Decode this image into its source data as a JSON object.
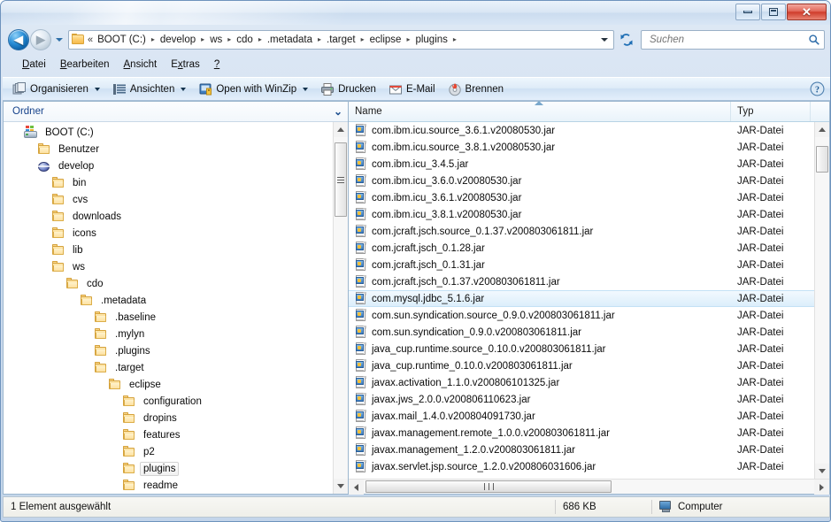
{
  "window": {
    "minimize_title": "Minimieren",
    "maximize_title": "Maximieren",
    "close_title": "Schließen"
  },
  "nav": {
    "back_glyph": "◀",
    "forward_glyph": "▶",
    "recent_pages_label": "Zuletzt besuchte Seiten",
    "crumb_lead": "«",
    "separator": "▸",
    "breadcrumbs": [
      {
        "label": "BOOT (C:)"
      },
      {
        "label": "develop"
      },
      {
        "label": "ws"
      },
      {
        "label": "cdo"
      },
      {
        "label": ".metadata"
      },
      {
        "label": ".target"
      },
      {
        "label": "eclipse"
      },
      {
        "label": "plugins"
      }
    ],
    "refresh_label": "Aktualisieren"
  },
  "search": {
    "value": "",
    "placeholder": "Suchen",
    "icon": "search-icon"
  },
  "menu": {
    "items": [
      {
        "pre": "",
        "accel": "D",
        "post": "atei"
      },
      {
        "pre": "",
        "accel": "B",
        "post": "earbeiten"
      },
      {
        "pre": "",
        "accel": "A",
        "post": "nsicht"
      },
      {
        "pre": "E",
        "accel": "x",
        "post": "tras"
      },
      {
        "pre": "",
        "accel": "?",
        "post": ""
      }
    ]
  },
  "toolbar": {
    "buttons": [
      {
        "label": "Organisieren",
        "icon": "organize-icon",
        "caret": true
      },
      {
        "label": "Ansichten",
        "icon": "views-icon",
        "caret": true
      },
      {
        "label": "Open with WinZip",
        "icon": "winzip-icon",
        "caret": true
      },
      {
        "label": "Drucken",
        "icon": "printer-icon",
        "caret": false
      },
      {
        "label": "E-Mail",
        "icon": "mail-icon",
        "caret": false
      },
      {
        "label": "Brennen",
        "icon": "burn-icon",
        "caret": false
      }
    ],
    "help_label": "Hilfe",
    "help_icon": "help-icon"
  },
  "tree": {
    "header": "Ordner",
    "header_icon": "chevron-down-icon",
    "items": [
      {
        "label": "BOOT (C:)",
        "indent": 0,
        "icon": "drive-icon",
        "selected": false
      },
      {
        "label": "Benutzer",
        "indent": 1,
        "icon": "folder-icon",
        "selected": false
      },
      {
        "label": "develop",
        "indent": 1,
        "icon": "globe-icon",
        "selected": false
      },
      {
        "label": "bin",
        "indent": 2,
        "icon": "folder-icon",
        "selected": false
      },
      {
        "label": "cvs",
        "indent": 2,
        "icon": "folder-icon",
        "selected": false
      },
      {
        "label": "downloads",
        "indent": 2,
        "icon": "folder-icon",
        "selected": false
      },
      {
        "label": "icons",
        "indent": 2,
        "icon": "folder-icon",
        "selected": false
      },
      {
        "label": "lib",
        "indent": 2,
        "icon": "folder-icon",
        "selected": false
      },
      {
        "label": "ws",
        "indent": 2,
        "icon": "folder-icon",
        "selected": false
      },
      {
        "label": "cdo",
        "indent": 3,
        "icon": "folder-icon",
        "selected": false
      },
      {
        "label": ".metadata",
        "indent": 4,
        "icon": "folder-icon",
        "selected": false
      },
      {
        "label": ".baseline",
        "indent": 5,
        "icon": "folder-icon",
        "selected": false
      },
      {
        "label": ".mylyn",
        "indent": 5,
        "icon": "folder-icon",
        "selected": false
      },
      {
        "label": ".plugins",
        "indent": 5,
        "icon": "folder-icon",
        "selected": false
      },
      {
        "label": ".target",
        "indent": 5,
        "icon": "folder-icon",
        "selected": false
      },
      {
        "label": "eclipse",
        "indent": 6,
        "icon": "folder-icon",
        "selected": false
      },
      {
        "label": "configuration",
        "indent": 7,
        "icon": "folder-icon",
        "selected": false
      },
      {
        "label": "dropins",
        "indent": 7,
        "icon": "folder-icon",
        "selected": false
      },
      {
        "label": "features",
        "indent": 7,
        "icon": "folder-icon",
        "selected": false
      },
      {
        "label": "p2",
        "indent": 7,
        "icon": "folder-icon",
        "selected": false
      },
      {
        "label": "plugins",
        "indent": 7,
        "icon": "folder-icon",
        "selected": true
      },
      {
        "label": "readme",
        "indent": 7,
        "icon": "folder-icon",
        "selected": false
      }
    ]
  },
  "filelist": {
    "columns": [
      {
        "key": "name",
        "label": "Name",
        "sorted": "asc"
      },
      {
        "key": "typ",
        "label": "Typ",
        "sorted": ""
      }
    ],
    "rows": [
      {
        "name": "com.ibm.icu.source_3.6.1.v20080530.jar",
        "typ": "JAR-Datei",
        "icon": "jar-file-icon",
        "selected": false
      },
      {
        "name": "com.ibm.icu.source_3.8.1.v20080530.jar",
        "typ": "JAR-Datei",
        "icon": "jar-file-icon",
        "selected": false
      },
      {
        "name": "com.ibm.icu_3.4.5.jar",
        "typ": "JAR-Datei",
        "icon": "jar-file-icon",
        "selected": false
      },
      {
        "name": "com.ibm.icu_3.6.0.v20080530.jar",
        "typ": "JAR-Datei",
        "icon": "jar-file-icon",
        "selected": false
      },
      {
        "name": "com.ibm.icu_3.6.1.v20080530.jar",
        "typ": "JAR-Datei",
        "icon": "jar-file-icon",
        "selected": false
      },
      {
        "name": "com.ibm.icu_3.8.1.v20080530.jar",
        "typ": "JAR-Datei",
        "icon": "jar-file-icon",
        "selected": false
      },
      {
        "name": "com.jcraft.jsch.source_0.1.37.v200803061811.jar",
        "typ": "JAR-Datei",
        "icon": "jar-file-icon",
        "selected": false
      },
      {
        "name": "com.jcraft.jsch_0.1.28.jar",
        "typ": "JAR-Datei",
        "icon": "jar-file-icon",
        "selected": false
      },
      {
        "name": "com.jcraft.jsch_0.1.31.jar",
        "typ": "JAR-Datei",
        "icon": "jar-file-icon",
        "selected": false
      },
      {
        "name": "com.jcraft.jsch_0.1.37.v200803061811.jar",
        "typ": "JAR-Datei",
        "icon": "jar-file-icon",
        "selected": false
      },
      {
        "name": "com.mysql.jdbc_5.1.6.jar",
        "typ": "JAR-Datei",
        "icon": "jar-file-icon",
        "selected": true
      },
      {
        "name": "com.sun.syndication.source_0.9.0.v200803061811.jar",
        "typ": "JAR-Datei",
        "icon": "jar-file-icon",
        "selected": false
      },
      {
        "name": "com.sun.syndication_0.9.0.v200803061811.jar",
        "typ": "JAR-Datei",
        "icon": "jar-file-icon",
        "selected": false
      },
      {
        "name": "java_cup.runtime.source_0.10.0.v200803061811.jar",
        "typ": "JAR-Datei",
        "icon": "jar-file-icon",
        "selected": false
      },
      {
        "name": "java_cup.runtime_0.10.0.v200803061811.jar",
        "typ": "JAR-Datei",
        "icon": "jar-file-icon",
        "selected": false
      },
      {
        "name": "javax.activation_1.1.0.v200806101325.jar",
        "typ": "JAR-Datei",
        "icon": "jar-file-icon",
        "selected": false
      },
      {
        "name": "javax.jws_2.0.0.v200806110623.jar",
        "typ": "JAR-Datei",
        "icon": "jar-file-icon",
        "selected": false
      },
      {
        "name": "javax.mail_1.4.0.v200804091730.jar",
        "typ": "JAR-Datei",
        "icon": "jar-file-icon",
        "selected": false
      },
      {
        "name": "javax.management.remote_1.0.0.v200803061811.jar",
        "typ": "JAR-Datei",
        "icon": "jar-file-icon",
        "selected": false
      },
      {
        "name": "javax.management_1.2.0.v200803061811.jar",
        "typ": "JAR-Datei",
        "icon": "jar-file-icon",
        "selected": false
      },
      {
        "name": "javax.servlet.jsp.source_1.2.0.v200806031606.jar",
        "typ": "JAR-Datei",
        "icon": "jar-file-icon",
        "selected": false
      }
    ]
  },
  "statusbar": {
    "selection_text": "1 Element ausgewählt",
    "size_text": "686 KB",
    "location_text": "Computer",
    "location_icon": "computer-icon"
  }
}
